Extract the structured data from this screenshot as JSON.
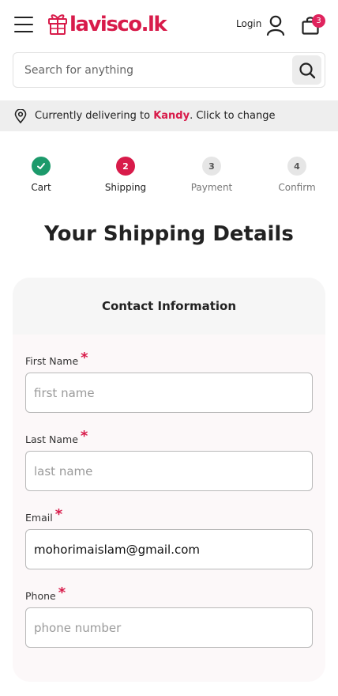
{
  "header": {
    "brand": "lavisco.lk",
    "login_label": "Login",
    "cart_count": "3",
    "brand_color": "#d81b4a"
  },
  "search": {
    "placeholder": "Search for anything"
  },
  "delivery": {
    "prefix": "Currently delivering to",
    "city": "Kandy",
    "suffix": ". Click to change"
  },
  "steps": [
    {
      "number": "1",
      "label": "Cart",
      "state": "done"
    },
    {
      "number": "2",
      "label": "Shipping",
      "state": "active"
    },
    {
      "number": "3",
      "label": "Payment",
      "state": "todo"
    },
    {
      "number": "4",
      "label": "Confirm",
      "state": "todo"
    }
  ],
  "page_title": "Your Shipping Details",
  "form": {
    "section_title": "Contact Information",
    "required_mark": "*",
    "fields": [
      {
        "label": "First Name",
        "placeholder": "first name",
        "value": ""
      },
      {
        "label": "Last Name",
        "placeholder": "last name",
        "value": ""
      },
      {
        "label": "Email",
        "placeholder": "",
        "value": "mohorimaislam@gmail.com"
      },
      {
        "label": "Phone",
        "placeholder": "phone number",
        "value": ""
      }
    ]
  },
  "icons": {
    "menu": "hamburger-icon",
    "logo": "gift-icon",
    "user": "user-icon",
    "cart": "shopping-bag-icon",
    "search": "search-icon",
    "location": "location-pin-icon",
    "check": "check-icon"
  }
}
